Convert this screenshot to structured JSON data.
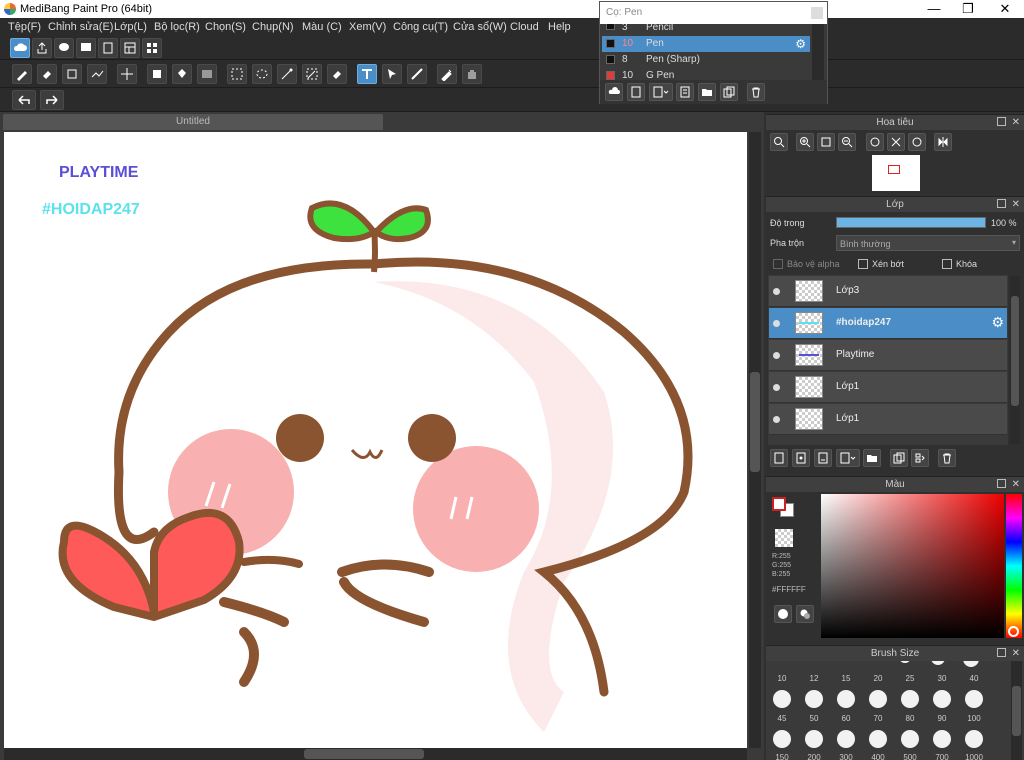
{
  "window": {
    "title": "MediBang Paint Pro (64bit)",
    "minimize": "—",
    "maximize": "❐",
    "close": "✕"
  },
  "menu": [
    "Tệp(F)",
    "Chỉnh sửa(E)",
    "Lớp(L)",
    "Bộ lọc(R)",
    "Chọn(S)",
    "Chụp(N)",
    "Màu (C)",
    "Xem(V)",
    "Công cụ(T)",
    "Cửa sổ(W)",
    "Cloud",
    "Help"
  ],
  "brush_panel": {
    "header": "Cọ: Pen",
    "items": [
      {
        "size": "3",
        "name": "Pencil",
        "color": "#111111"
      },
      {
        "size": "10",
        "name": "Pen",
        "color": "#111111",
        "selected": true
      },
      {
        "size": "8",
        "name": "Pen (Sharp)",
        "color": "#111111"
      },
      {
        "size": "10",
        "name": "G Pen",
        "color": "#e23b3b"
      }
    ]
  },
  "document": {
    "tab": "Untitled"
  },
  "artwork": {
    "text1": "PLAYTIME",
    "text2": "#HOIDAP247",
    "text1_color": "#5a4fd6",
    "text2_color": "#5ce1ee",
    "outline": "#8b5431",
    "cheek": "#f7a2a2",
    "heart": "#ff5a5a",
    "sprout": "#3ee23e"
  },
  "navigator": {
    "title": "Hoa tiêu"
  },
  "layer_panel": {
    "title": "Lớp",
    "opacity_label": "Độ trong",
    "opacity_value": "100 %",
    "opacity": 1.0,
    "blend_label": "Pha trộn",
    "blend_value": "Bình thường",
    "protect_alpha": "Bảo vệ alpha",
    "clipping": "Xén bớt",
    "lock": "Khóa",
    "layers": [
      {
        "name": "Lớp3",
        "selected": false
      },
      {
        "name": "#hoidap247",
        "selected": true
      },
      {
        "name": "Playtime",
        "selected": false
      },
      {
        "name": "Lớp1",
        "selected": false
      },
      {
        "name": "Lớp1",
        "selected": false
      }
    ]
  },
  "color_panel": {
    "title": "Màu",
    "r": "R:255",
    "g": "G:255",
    "b": "B:255",
    "hex": "#FFFFFF",
    "fg": "#ffffff",
    "bg": "#ffffff"
  },
  "brush_size_panel": {
    "title": "Brush Size",
    "row1": [
      "10",
      "12",
      "15",
      "20",
      "25",
      "30",
      "40"
    ],
    "row2": [
      "45",
      "50",
      "60",
      "70",
      "80",
      "90",
      "100"
    ],
    "row3": [
      "150",
      "200",
      "300",
      "400",
      "500",
      "700",
      "1000"
    ]
  }
}
